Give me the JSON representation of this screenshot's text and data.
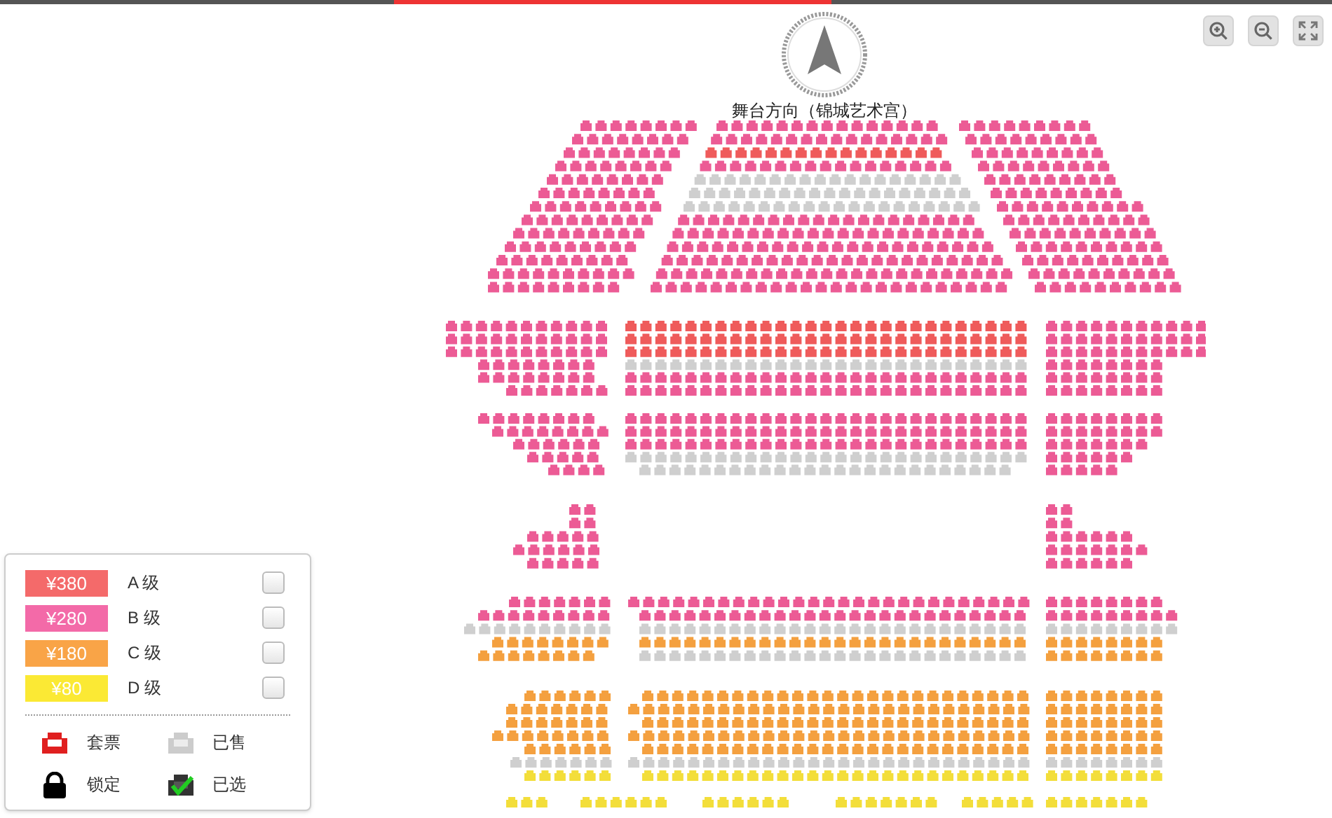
{
  "compass": {
    "label": "舞台方向（锦城艺术宫）"
  },
  "seat_map": {
    "sections": [
      {
        "rows": [
          [
            {
              "color": "#ec5b95"
            },
            {
              "color": "#ec5b95"
            },
            {
              "color": "#ec5b95"
            }
          ],
          [
            {
              "color": "#ec5b95"
            },
            {
              "color": "#ec5b95"
            },
            {
              "color": "#ec5b95"
            }
          ],
          [
            {
              "color": "#ec5b95"
            },
            {
              "color": "#ef5b5b"
            },
            {
              "color": "#ec5b95"
            }
          ],
          [
            {
              "color": "#ec5b95"
            },
            {
              "color": "#ec5b95"
            },
            {
              "color": "#ec5b95"
            }
          ],
          [
            {
              "color": "#ec5b95"
            },
            {
              "color": "#cfcfcf"
            },
            {
              "color": "#ec5b95"
            }
          ],
          [
            {
              "color": "#ec5b95"
            },
            {
              "color": "#cfcfcf"
            },
            {
              "color": "#ec5b95"
            }
          ],
          [
            {
              "color": "#ec5b95"
            },
            {
              "color": "#cfcfcf"
            },
            {
              "color": "#ec5b95"
            }
          ],
          [
            {
              "color": "#ec5b95"
            },
            {
              "color": "#ec5b95"
            },
            {
              "color": "#ec5b95"
            }
          ],
          [
            {
              "color": "#ec5b95"
            },
            {
              "color": "#ec5b95"
            },
            {
              "color": "#ec5b95"
            }
          ],
          [
            {
              "color": "#ec5b95"
            },
            {
              "color": "#ec5b95"
            },
            {
              "color": "#ec5b95"
            }
          ],
          [
            {
              "color": "#ec5b95"
            },
            {
              "color": "#ec5b95"
            },
            {
              "color": "#ec5b95"
            }
          ],
          [
            {
              "color": "#ec5b95"
            },
            {
              "color": "#ec5b95"
            },
            {
              "color": "#ec5b95"
            }
          ],
          [
            {
              "color": "#ec5b95"
            },
            {
              "color": "#ec5b95"
            },
            {
              "color": "#ec5b95"
            }
          ]
        ]
      },
      {
        "rows": [
          [
            {
              "color": "#ec5b95"
            },
            {
              "color": "#ef5b5b"
            },
            {
              "color": "#ec5b95"
            }
          ],
          [
            {
              "color": "#ec5b95"
            },
            {
              "color": "#ef5b5b"
            },
            {
              "color": "#ec5b95"
            }
          ],
          [
            {
              "color": "#ec5b95"
            },
            {
              "color": "#ef5b5b"
            },
            {
              "color": "#ec5b95"
            }
          ],
          [
            {
              "color": "#ec5b95"
            },
            {
              "color": "#cfcfcf"
            },
            {
              "color": "#ec5b95"
            }
          ],
          [
            {
              "color": "#ec5b95"
            },
            {
              "color": "#ec5b95"
            },
            {
              "color": "#ec5b95"
            }
          ],
          [
            {
              "color": "#ec5b95"
            },
            {
              "color": "#ec5b95"
            },
            {
              "color": "#ec5b95"
            }
          ]
        ]
      },
      {
        "rows": [
          [
            {
              "color": "#ec5b95"
            },
            {
              "color": "#ec5b95"
            },
            {
              "color": "#ec5b95"
            }
          ],
          [
            {
              "color": "#ec5b95"
            },
            {
              "color": "#ec5b95"
            },
            {
              "color": "#ec5b95"
            }
          ],
          [
            {
              "color": "#ec5b95"
            },
            {
              "color": "#ec5b95"
            },
            {
              "color": "#ec5b95"
            }
          ],
          [
            {
              "color": "#ec5b95"
            },
            {
              "color": "#cfcfcf"
            },
            {
              "color": "#ec5b95"
            }
          ],
          [
            {
              "color": "#ec5b95"
            },
            {
              "color": "#cfcfcf"
            },
            {
              "color": "#ec5b95"
            }
          ]
        ]
      },
      {
        "rows": [
          [
            {
              "color": "#ec5b95"
            },
            {
              "color": "#ec5b95"
            }
          ],
          [
            {
              "color": "#ec5b95"
            },
            {
              "color": "#ec5b95"
            }
          ],
          [
            {
              "color": "#ec5b95"
            },
            {
              "color": "#ec5b95"
            }
          ],
          [
            {
              "color": "#ec5b95"
            },
            {
              "color": "#ec5b95"
            }
          ],
          [
            {
              "color": "#ec5b95"
            },
            {
              "color": "#ec5b95"
            }
          ]
        ]
      },
      {
        "rows": [
          [
            {
              "color": "#ec5b95"
            },
            {
              "color": "#ec5b95"
            },
            {
              "color": "#ec5b95"
            }
          ],
          [
            {
              "color": "#ec5b95"
            },
            {
              "color": "#ec5b95"
            },
            {
              "color": "#ec5b95"
            }
          ],
          [
            {
              "color": "#cfcfcf"
            },
            {
              "color": "#cfcfcf"
            },
            {
              "color": "#cfcfcf"
            }
          ],
          [
            {
              "color": "#f4a03f"
            },
            {
              "color": "#f4a03f"
            },
            {
              "color": "#f4a03f"
            }
          ],
          [
            {
              "color": "#f4a03f"
            },
            {
              "color": "#cfcfcf"
            },
            {
              "color": "#f4a03f"
            }
          ]
        ]
      },
      {
        "rows": [
          [
            {
              "color": "#f4a03f"
            },
            {
              "color": "#f4a03f"
            },
            {
              "color": "#f4a03f"
            }
          ],
          [
            {
              "color": "#f4a03f"
            },
            {
              "color": "#f4a03f"
            },
            {
              "color": "#f4a03f"
            }
          ],
          [
            {
              "color": "#f4a03f"
            },
            {
              "color": "#f4a03f"
            },
            {
              "color": "#f4a03f"
            }
          ],
          [
            {
              "color": "#f4a03f"
            },
            {
              "color": "#f4a03f"
            },
            {
              "color": "#f4a03f"
            }
          ],
          [
            {
              "color": "#f4a03f"
            },
            {
              "color": "#f4a03f"
            },
            {
              "color": "#f4a03f"
            }
          ],
          [
            {
              "color": "#cfcfcf"
            },
            {
              "color": "#cfcfcf"
            },
            {
              "color": "#cfcfcf"
            }
          ],
          [
            {
              "color": "#f3de3a"
            },
            {
              "color": "#f3de3a"
            },
            {
              "color": "#f3de3a"
            }
          ]
        ]
      },
      {
        "rows": [
          [
            {
              "color": "#f3de3a"
            },
            {
              "color": "#f3de3a"
            },
            {
              "color": "#f3de3a"
            },
            {
              "color": "#f3de3a"
            },
            {
              "color": "#f3de3a"
            },
            {
              "color": "#f3de3a"
            }
          ]
        ]
      }
    ]
  },
  "legend": {
    "grades": [
      {
        "price": "¥380",
        "label": "A 级",
        "color": "#f46a6a",
        "checked": false
      },
      {
        "price": "¥280",
        "label": "B 级",
        "color": "#f36aa8",
        "checked": false
      },
      {
        "price": "¥180",
        "label": "C 级",
        "color": "#f9a447",
        "checked": false
      },
      {
        "price": "¥80",
        "label": "D 级",
        "color": "#fbe934",
        "checked": false
      }
    ],
    "statuses": [
      {
        "kind": "package",
        "label": "套票"
      },
      {
        "kind": "sold",
        "label": "已售"
      },
      {
        "kind": "locked",
        "label": "锁定"
      },
      {
        "kind": "selected",
        "label": "已选"
      }
    ]
  }
}
